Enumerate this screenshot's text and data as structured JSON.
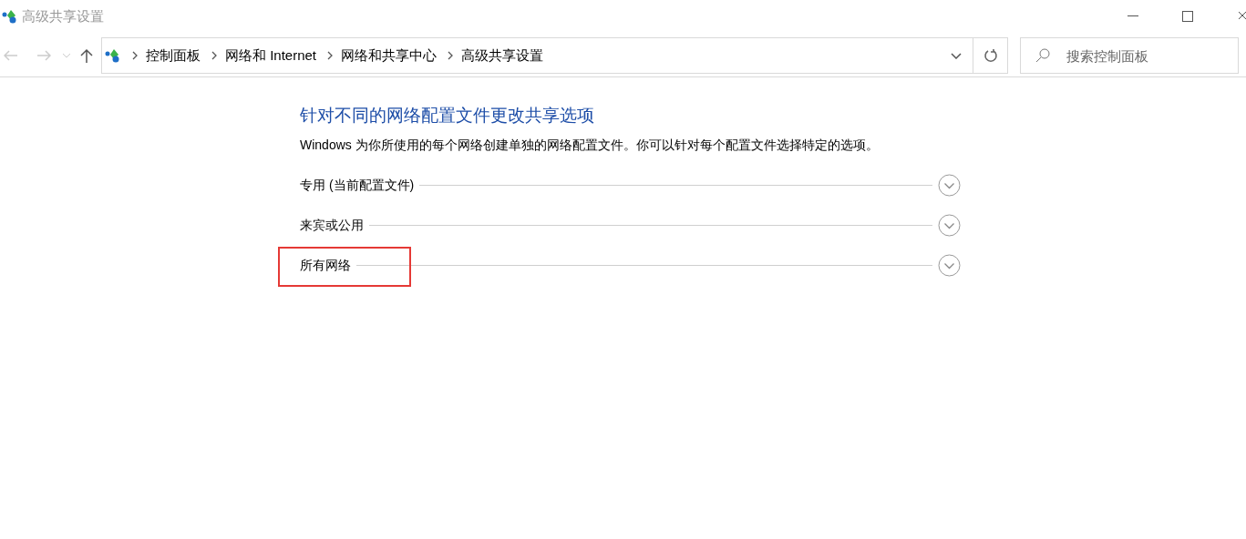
{
  "window": {
    "title": "高级共享设置"
  },
  "breadcrumbs": [
    "控制面板",
    "网络和 Internet",
    "网络和共享中心",
    "高级共享设置"
  ],
  "search": {
    "placeholder": "搜索控制面板"
  },
  "heading": "针对不同的网络配置文件更改共享选项",
  "description": "Windows 为你所使用的每个网络创建单独的网络配置文件。你可以针对每个配置文件选择特定的选项。",
  "sections": [
    {
      "label": "专用 (当前配置文件)",
      "expanded": false,
      "highlighted": false
    },
    {
      "label": "来宾或公用",
      "expanded": false,
      "highlighted": false
    },
    {
      "label": "所有网络",
      "expanded": false,
      "highlighted": true
    }
  ]
}
